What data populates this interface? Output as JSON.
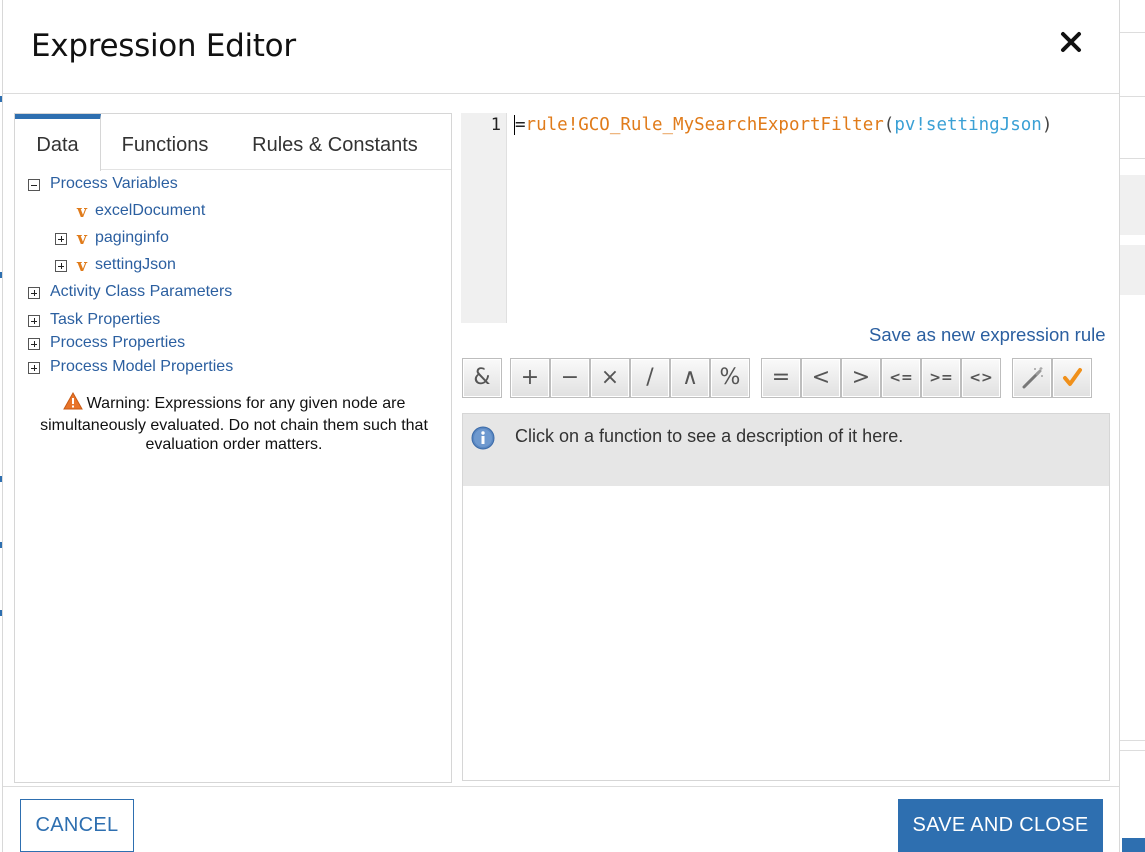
{
  "dialog": {
    "title": "Expression Editor",
    "close_icon": "close-icon"
  },
  "tabs": [
    {
      "label": "Data",
      "active": true
    },
    {
      "label": "Functions",
      "active": false
    },
    {
      "label": "Rules & Constants",
      "active": false
    }
  ],
  "tree": {
    "process_variables": {
      "label": "Process Variables",
      "expanded": true,
      "children": [
        {
          "label": "excelDocument",
          "expandable": false
        },
        {
          "label": "paginginfo",
          "expandable": true
        },
        {
          "label": "settingJson",
          "expandable": true
        }
      ]
    },
    "activity_class_parameters": "Activity Class Parameters",
    "task_properties": "Task Properties",
    "process_properties": "Process Properties",
    "process_model_properties": "Process Model Properties"
  },
  "warning": {
    "line1": "Warning: Expressions for any given node are",
    "line2": "simultaneously evaluated. Do not chain them such that",
    "line3": "evaluation order matters."
  },
  "editor": {
    "line_number": "1",
    "code_eq": "=",
    "code_rule": "rule!GCO_Rule_MySearchExportFilter",
    "code_open": "(",
    "code_arg": "pv!settingJson",
    "code_close": ")"
  },
  "save_rule_link": "Save as new expression rule",
  "operators": [
    "&",
    "+",
    "−",
    "×",
    "/",
    "∧",
    "%",
    "=",
    "<",
    ">",
    "<=",
    ">=",
    "<>"
  ],
  "tools": [
    "magic-wand-icon",
    "checkmark-icon"
  ],
  "description": "Click on a function to see a description of it here.",
  "footer": {
    "cancel": "CANCEL",
    "save_and_close": "SAVE AND CLOSE"
  },
  "colors": {
    "accent": "#2e6fb0",
    "rule": "#e07b1a",
    "pv": "#3aa0d5",
    "link": "#2b5fa0"
  }
}
